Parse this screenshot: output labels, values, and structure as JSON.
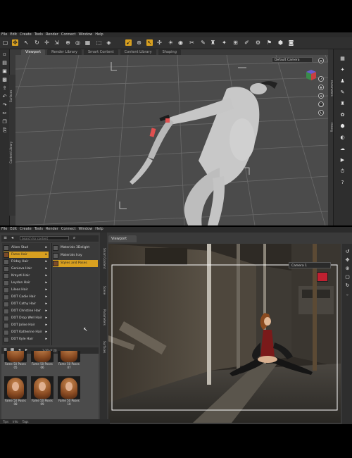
{
  "top_window": {
    "menu": [
      "File",
      "Edit",
      "Create",
      "Tools",
      "Render",
      "Connect",
      "Window",
      "Help"
    ],
    "viewport_tabs": [
      "Viewport",
      "Render Library",
      "Smart Content",
      "Content Library",
      "Shaping"
    ],
    "camera": "Default Camera",
    "left_vtabs": [
      "Surfaces",
      "Content Library"
    ],
    "right_vtabs": [
      "Parameters",
      "Posing"
    ],
    "colors": {
      "accent": "#d8a020",
      "viewport_bg": "#4a4a4a",
      "figure": "#c4c4c4"
    }
  },
  "bottom_window": {
    "menu": [
      "File",
      "Edit",
      "Create",
      "Tools",
      "Render",
      "Connect",
      "Window",
      "Help"
    ],
    "search_placeholder": "Search for content",
    "categories": [
      "Aiken Stud",
      "Fame Hair",
      "Friday Hair",
      "Genieva Hair",
      "Kraysti Hair",
      "Leydon Hair",
      "Lileas Hair",
      "DOT Cadie Hair",
      "DOT Cathy Hair",
      "DOT Christine Hair",
      "DOT Drop Well Hair",
      "DOT Jolise Hair",
      "DOT Katherine Hair",
      "DOT Kyle Hair"
    ],
    "selected_category": "Fame Hair",
    "subcategories": [
      "Materials 3Delight",
      "Materials Iray",
      "Styles and Poses"
    ],
    "selected_subcategory": "Styles and Poses",
    "count_label": "1-20 of 20",
    "assets": [
      "Fame 50 Poses 05",
      "Fame 50 Poses 06",
      "Fame 50 Poses 07",
      "Fame 50 Poses 08",
      "Fame 50 Poses 09",
      "Fame 50 Poses 10"
    ],
    "side_tabs": [
      "Smart Content",
      "Scene",
      "Parameters",
      "Surfaces"
    ],
    "viewport_tab": "Viewport",
    "camera": "Camera 1",
    "bottom_tabs": [
      "Tips",
      "Info",
      "Tags"
    ]
  }
}
